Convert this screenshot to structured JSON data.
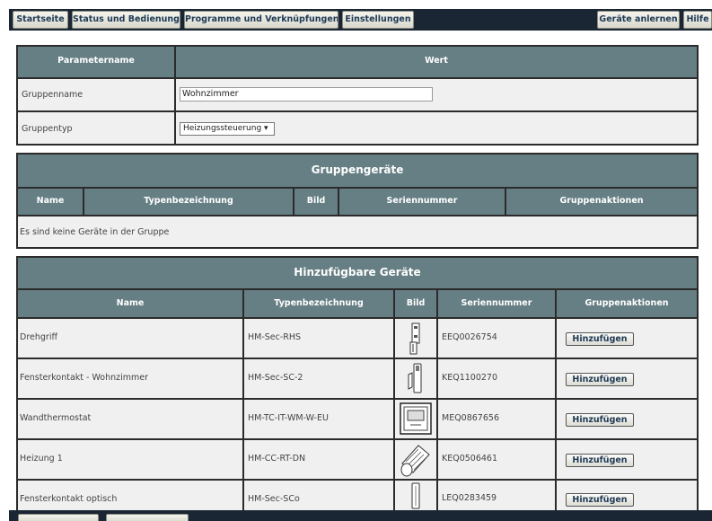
{
  "nav": {
    "home": "Startseite",
    "status": "Status und Bedienung",
    "programs": "Programme und Verknüpfungen",
    "settings": "Einstellungen",
    "teach": "Geräte anlernen",
    "help": "Hilfe"
  },
  "params": {
    "col_name": "Parametername",
    "col_value": "Wert",
    "group_name_label": "Gruppenname",
    "group_name_value": "Wohnzimmer",
    "group_type_label": "Gruppentyp",
    "group_type_value": "Heizungssteuerung ▾"
  },
  "group_devices": {
    "title": "Gruppengeräte",
    "headers": [
      "Name",
      "Typenbezeichnung",
      "Bild",
      "Seriennummer",
      "Gruppenaktionen"
    ],
    "empty": "Es sind keine Geräte in der Gruppe"
  },
  "available": {
    "title": "Hinzufügbare Geräte",
    "headers": [
      "Name",
      "Typenbezeichnung",
      "Bild",
      "Seriennummer",
      "Gruppenaktionen"
    ],
    "action_label": "Hinzufügen",
    "rows": [
      {
        "name": "Drehgriff",
        "type": "HM-Sec-RHS",
        "serial": "EEQ0026754",
        "icon": "window-handle-icon"
      },
      {
        "name": "Fensterkontakt - Wohnzimmer",
        "type": "HM-Sec-SC-2",
        "serial": "KEQ1100270",
        "icon": "window-contact-icon"
      },
      {
        "name": "Wandthermostat",
        "type": "HM-TC-IT-WM-W-EU",
        "serial": "MEQ0867656",
        "icon": "wall-thermostat-icon"
      },
      {
        "name": "Heizung 1",
        "type": "HM-CC-RT-DN",
        "serial": "KEQ0506461",
        "icon": "radiator-thermostat-icon"
      },
      {
        "name": "Fensterkontakt optisch",
        "type": "HM-Sec-SCo",
        "serial": "LEQ0283459",
        "icon": "optical-contact-icon"
      }
    ]
  }
}
